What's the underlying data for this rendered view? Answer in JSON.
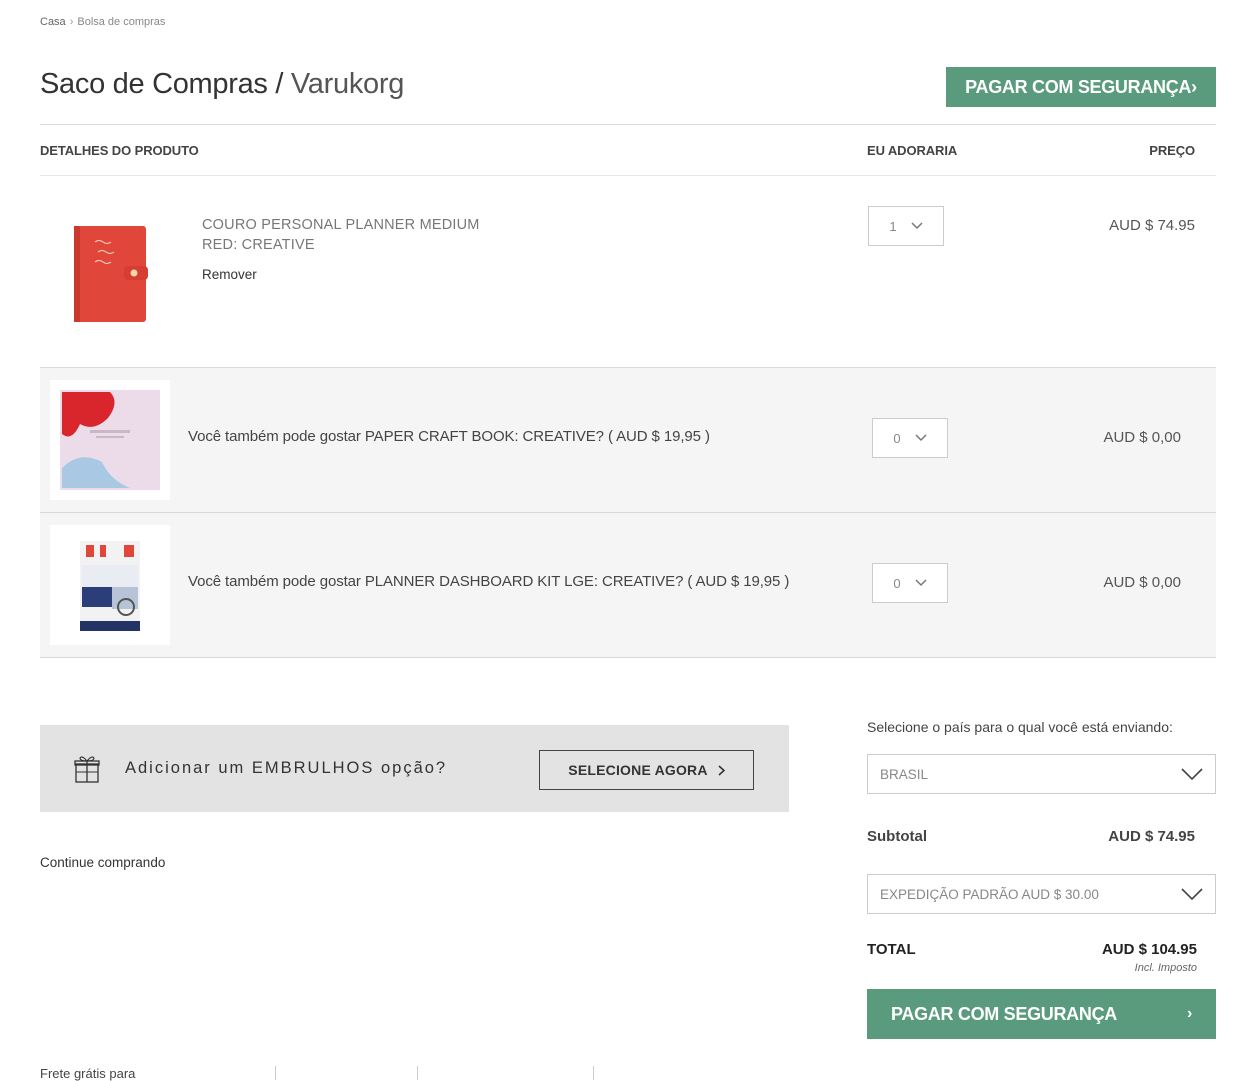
{
  "breadcrumb": {
    "home": "Casa",
    "separator": "›",
    "current": "Bolsa de compras"
  },
  "header": {
    "title": "Saco de Compras",
    "title_sep": "/",
    "brand": "Varukorg",
    "pay_button": "PAGAR COM SEGURANÇA›"
  },
  "columns": {
    "product": "DETALHES DO PRODUTO",
    "qty": "EU ADORARIA",
    "price": "PREÇO"
  },
  "cart_item": {
    "name_line1": "COURO PERSONAL PLANNER MEDIUM",
    "name_line2": "RED: CREATIVE",
    "remove": "Remover",
    "qty": "1",
    "price": "AUD $ 74.95"
  },
  "upsells": [
    {
      "text": "Você também pode gostar PAPER CRAFT BOOK: CREATIVE? ( AUD $ 19,95 )",
      "qty": "0",
      "price": "AUD $ 0,00"
    },
    {
      "text": "Você também pode gostar PLANNER DASHBOARD KIT LGE: CREATIVE? ( AUD $ 19,95 )",
      "qty": "0",
      "price": "AUD $ 0,00"
    }
  ],
  "gift": {
    "text": "Adicionar um EMBRULHOS opção?",
    "button": "SELECIONE AGORA"
  },
  "continue": "Continue comprando",
  "summary": {
    "country_label": "Selecione o país para o qual você está enviando:",
    "country": "BRASIL",
    "subtotal_label": "Subtotal",
    "subtotal": "AUD $ 74.95",
    "shipping": "EXPEDIÇÃO PADRÃO AUD $ 30.00",
    "total_label": "TOTAL",
    "total": "AUD $ 104.95",
    "tax_note": "Incl. Imposto",
    "pay_button": "PAGAR COM SEGURANÇA",
    "pay_arrow": "›"
  },
  "footer": {
    "free_shipping": "Frete grátis para"
  },
  "colors": {
    "accent": "#5a9b7e",
    "planner_red": "#e0463a"
  }
}
